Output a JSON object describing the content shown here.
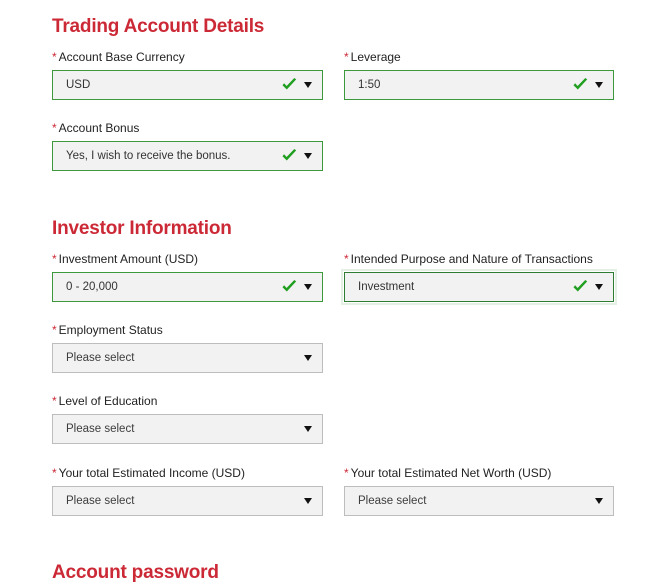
{
  "sections": [
    {
      "id": "trading",
      "title": "Trading Account Details"
    },
    {
      "id": "investor",
      "title": "Investor Information"
    },
    {
      "id": "password",
      "title": "Account password"
    }
  ],
  "fields": {
    "account_base_currency": {
      "label": "Account Base Currency",
      "required_marker": "*",
      "value": "USD",
      "state": "filled",
      "valid_icon": "green-check-icon",
      "caret_icon": "caret-down-icon"
    },
    "leverage": {
      "label": "Leverage",
      "required_marker": "*",
      "value": "1:50",
      "state": "filled",
      "valid_icon": "green-check-icon",
      "caret_icon": "caret-down-icon"
    },
    "account_bonus": {
      "label": "Account Bonus",
      "required_marker": "*",
      "value": "Yes, I wish to receive the bonus.",
      "state": "filled",
      "valid_icon": "green-check-icon",
      "caret_icon": "caret-down-icon"
    },
    "investment_amount": {
      "label": "Investment Amount (USD)",
      "required_marker": "*",
      "value": "0 - 20,000",
      "state": "filled",
      "valid_icon": "green-check-icon",
      "caret_icon": "caret-down-icon"
    },
    "intended_purpose": {
      "label": "Intended Purpose and Nature of Transactions",
      "required_marker": "*",
      "value": "Investment",
      "state": "focused",
      "valid_icon": "green-check-icon",
      "caret_icon": "caret-down-icon"
    },
    "employment_status": {
      "label": "Employment Status",
      "required_marker": "*",
      "value": "Please select",
      "state": "empty",
      "caret_icon": "caret-down-icon"
    },
    "level_of_education": {
      "label": "Level of Education",
      "required_marker": "*",
      "value": "Please select",
      "state": "empty",
      "caret_icon": "caret-down-icon"
    },
    "estimated_income": {
      "label": "Your total Estimated Income (USD)",
      "required_marker": "*",
      "value": "Please select",
      "state": "empty",
      "caret_icon": "caret-down-icon"
    },
    "estimated_net_worth": {
      "label": "Your total Estimated Net Worth (USD)",
      "required_marker": "*",
      "value": "Please select",
      "state": "empty",
      "caret_icon": "caret-down-icon"
    }
  },
  "colors": {
    "heading": "#cc2936",
    "valid_border": "#3c9a3c",
    "default_border": "#bdbdbd",
    "field_background": "#f2f2f2",
    "check_green": "#1f9e1f"
  }
}
